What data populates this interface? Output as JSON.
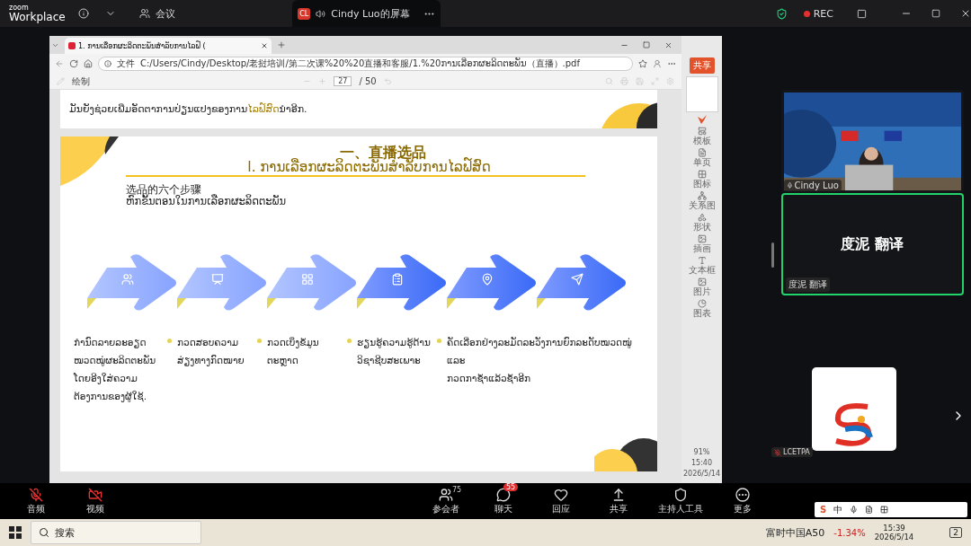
{
  "zoom_bar": {
    "logo_top": "zoom",
    "logo_bottom": "Workplace",
    "meeting_label": "会议",
    "share_tab": {
      "initials": "CL",
      "title": "Cindy Luo的屏幕"
    },
    "rec": "REC"
  },
  "browser": {
    "tab_title": "1. ການເລືອກຜະລິດຕະພັນສຳລັບການໄລຟ໌ (",
    "address_prefix": "文件",
    "url": "C:/Users/Cindy/Desktop/老挝培训/第二次课%20%20直播和客服/1.%20ການເລືອກຜະລິດຕະພັນ（直播）.pdf",
    "draw_label": "绘制",
    "page": "27",
    "page_total": "/ 50"
  },
  "prev_page": {
    "parts": [
      {
        "text": "ມັນຍັງຊ່ວຍເພີ່ມອັດຕາການປ່ຽນແປງຂອງການ",
        "highlight": false
      },
      {
        "text": "ໄລຟ໌ສົດ",
        "highlight": true
      },
      {
        "text": "ນຳອີກ.",
        "highlight": false
      }
    ]
  },
  "slide": {
    "title_cn": "一、直播选品",
    "title_lao": "I. ການເລືອກຜະລິດຕະພັນສຳລັບການໄລຟ໌ສົດ",
    "subtitle_cn": "选品的六个步骤",
    "subtitle_lao": "ຫົກຂັ້ນຕອນໃນການເລືອກຜະລິດຕະພັນ",
    "steps": [
      {
        "kind": "arrow",
        "lines": [
          "ກຳນົດລາຍລະອຽດໝວດໝູ່ຜະລິດຕະພັນໂດຍອີງໃສ່ຄວາມຕ້ອງການຂອງຜູ້ໃຊ້."
        ]
      },
      {
        "kind": "arrow",
        "lines": [
          "ກວດສອບຄວາມສ່ຽງທາງກົດໝາຍ"
        ]
      },
      {
        "kind": "arrow",
        "lines": [
          "ກວດເບິ່ງຂໍ້ມູນຕະຫຼາດ"
        ]
      },
      {
        "kind": "arrow",
        "lines": [
          "ຮຽນຮູ້ຄວາມຮູ້ດ້ານວິຊາຊີບສະເພາະ"
        ]
      },
      {
        "kind": "arrow",
        "lines": [
          "ຄັດເລືອກຢ່າງລະມັດລະວັງການຍົກລະດັບໝວດໝູ່",
          "ແລະ",
          "ກວດກາຊ້ຳແລ້ວຊ້ຳອີກ"
        ]
      },
      {
        "kind": "arrow"
      }
    ]
  },
  "side_panel": {
    "share_button": "共享",
    "tools": [
      "模板",
      "单页",
      "图标",
      "关系图",
      "形状",
      "插画",
      "文本框",
      "图片",
      "图表"
    ],
    "zoom": "91%",
    "time": "15:40",
    "date": "2026/5/14"
  },
  "participants": [
    {
      "kind": "video",
      "name": "Cindy Luo",
      "speaking": false
    },
    {
      "kind": "avatar",
      "display": "度泥 翻译",
      "name": "度泥 翻译",
      "speaking": true
    },
    {
      "kind": "logo",
      "name": "LCETPA",
      "speaking": false
    }
  ],
  "toolbar": [
    {
      "label": "音频",
      "kind": "mic"
    },
    {
      "label": "视频",
      "kind": "video"
    },
    {
      "label": "参会者",
      "kind": "users",
      "count": "75"
    },
    {
      "label": "聊天",
      "kind": "chat",
      "badge": "55"
    },
    {
      "label": "回应",
      "kind": "heart"
    },
    {
      "label": "共享",
      "kind": "share"
    },
    {
      "label": "主持人工具",
      "kind": "shield"
    },
    {
      "label": "更多",
      "kind": "more"
    }
  ],
  "ime": {
    "logo": "S",
    "mode": "中"
  },
  "taskbar": {
    "search": "搜索",
    "stock_name": "富时中国A50",
    "stock_change": "-1.34%",
    "time": "15:39",
    "date": "2026/5/14",
    "notifications": "2"
  }
}
